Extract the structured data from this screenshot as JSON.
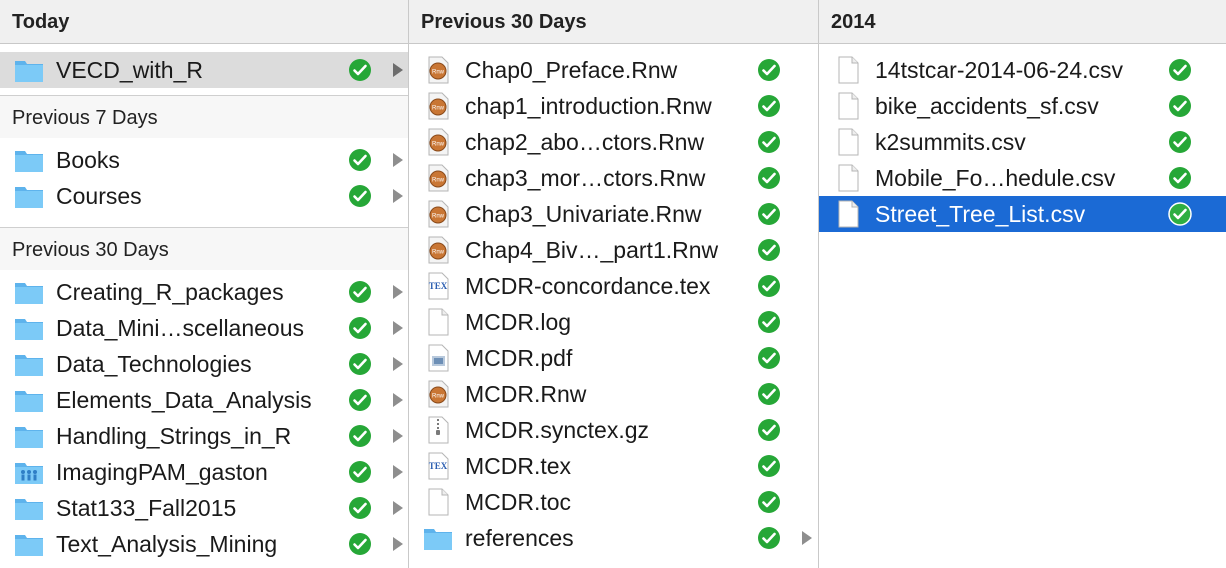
{
  "colors": {
    "selected_row": "#1b6ad5",
    "inactive_selection": "#dcdcdc",
    "sync_check": "#26a737",
    "folder": "#68bff3",
    "rnw_badge": "#c97634"
  },
  "column1": {
    "header": "Today",
    "sections": [
      "Previous 7 Days",
      "Previous 30 Days"
    ],
    "today_items": [
      {
        "label": "VECD_with_R",
        "icon": "folder-icon",
        "status": "synced-check-icon",
        "has_children": true
      }
    ],
    "prev7_items": [
      {
        "label": "Books",
        "icon": "folder-icon",
        "status": "synced-check-icon",
        "has_children": true
      },
      {
        "label": "Courses",
        "icon": "folder-icon",
        "status": "synced-check-icon",
        "has_children": true
      }
    ],
    "prev30_items": [
      {
        "label": "Creating_R_packages",
        "icon": "folder-icon",
        "status": "synced-check-icon",
        "has_children": true
      },
      {
        "label": "Data_Mini…scellaneous",
        "icon": "folder-icon",
        "status": "synced-check-icon",
        "has_children": true
      },
      {
        "label": "Data_Technologies",
        "icon": "folder-icon",
        "status": "synced-check-icon",
        "has_children": true
      },
      {
        "label": "Elements_Data_Analysis",
        "icon": "folder-icon",
        "status": "synced-check-icon",
        "has_children": true
      },
      {
        "label": "Handling_Strings_in_R",
        "icon": "folder-icon",
        "status": "synced-check-icon",
        "has_children": true
      },
      {
        "label": "ImagingPAM_gaston",
        "icon": "shared-folder-icon",
        "status": "synced-check-icon",
        "has_children": true
      },
      {
        "label": "Stat133_Fall2015",
        "icon": "folder-icon",
        "status": "synced-check-icon",
        "has_children": true
      },
      {
        "label": "Text_Analysis_Mining",
        "icon": "folder-icon",
        "status": "synced-check-icon",
        "has_children": true
      }
    ]
  },
  "column2": {
    "header": "Previous 30 Days",
    "items": [
      {
        "label": "Chap0_Preface.Rnw",
        "icon": "rnw-file-icon",
        "status": "synced-check-icon",
        "has_children": false
      },
      {
        "label": "chap1_introduction.Rnw",
        "icon": "rnw-file-icon",
        "status": "synced-check-icon",
        "has_children": false
      },
      {
        "label": "chap2_abo…ctors.Rnw",
        "icon": "rnw-file-icon",
        "status": "synced-check-icon",
        "has_children": false
      },
      {
        "label": "chap3_mor…ctors.Rnw",
        "icon": "rnw-file-icon",
        "status": "synced-check-icon",
        "has_children": false
      },
      {
        "label": "Chap3_Univariate.Rnw",
        "icon": "rnw-file-icon",
        "status": "synced-check-icon",
        "has_children": false
      },
      {
        "label": "Chap4_Biv…_part1.Rnw",
        "icon": "rnw-file-icon",
        "status": "synced-check-icon",
        "has_children": false
      },
      {
        "label": "MCDR-concordance.tex",
        "icon": "tex-file-icon",
        "status": "synced-check-icon",
        "has_children": false
      },
      {
        "label": "MCDR.log",
        "icon": "blank-file-icon",
        "status": "synced-check-icon",
        "has_children": false
      },
      {
        "label": "MCDR.pdf",
        "icon": "pdf-file-icon",
        "status": "synced-check-icon",
        "has_children": false
      },
      {
        "label": "MCDR.Rnw",
        "icon": "rnw-file-icon",
        "status": "synced-check-icon",
        "has_children": false
      },
      {
        "label": "MCDR.synctex.gz",
        "icon": "archive-file-icon",
        "status": "synced-check-icon",
        "has_children": false
      },
      {
        "label": "MCDR.tex",
        "icon": "tex-file-icon",
        "status": "synced-check-icon",
        "has_children": false
      },
      {
        "label": "MCDR.toc",
        "icon": "blank-file-icon",
        "status": "synced-check-icon",
        "has_children": false
      },
      {
        "label": "references",
        "icon": "folder-icon",
        "status": "synced-check-icon",
        "has_children": true
      }
    ]
  },
  "column3": {
    "header": "2014",
    "items": [
      {
        "label": "14tstcar-2014-06-24.csv",
        "icon": "blank-file-icon",
        "status": "synced-check-icon",
        "has_children": false
      },
      {
        "label": "bike_accidents_sf.csv",
        "icon": "blank-file-icon",
        "status": "synced-check-icon",
        "has_children": false
      },
      {
        "label": "k2summits.csv",
        "icon": "blank-file-icon",
        "status": "synced-check-icon",
        "has_children": false
      },
      {
        "label": "Mobile_Fo…hedule.csv",
        "icon": "blank-file-icon",
        "status": "synced-check-icon",
        "has_children": false
      },
      {
        "label": "Street_Tree_List.csv",
        "icon": "blank-file-icon",
        "status": "synced-check-icon",
        "has_children": false,
        "selected": true
      }
    ]
  }
}
